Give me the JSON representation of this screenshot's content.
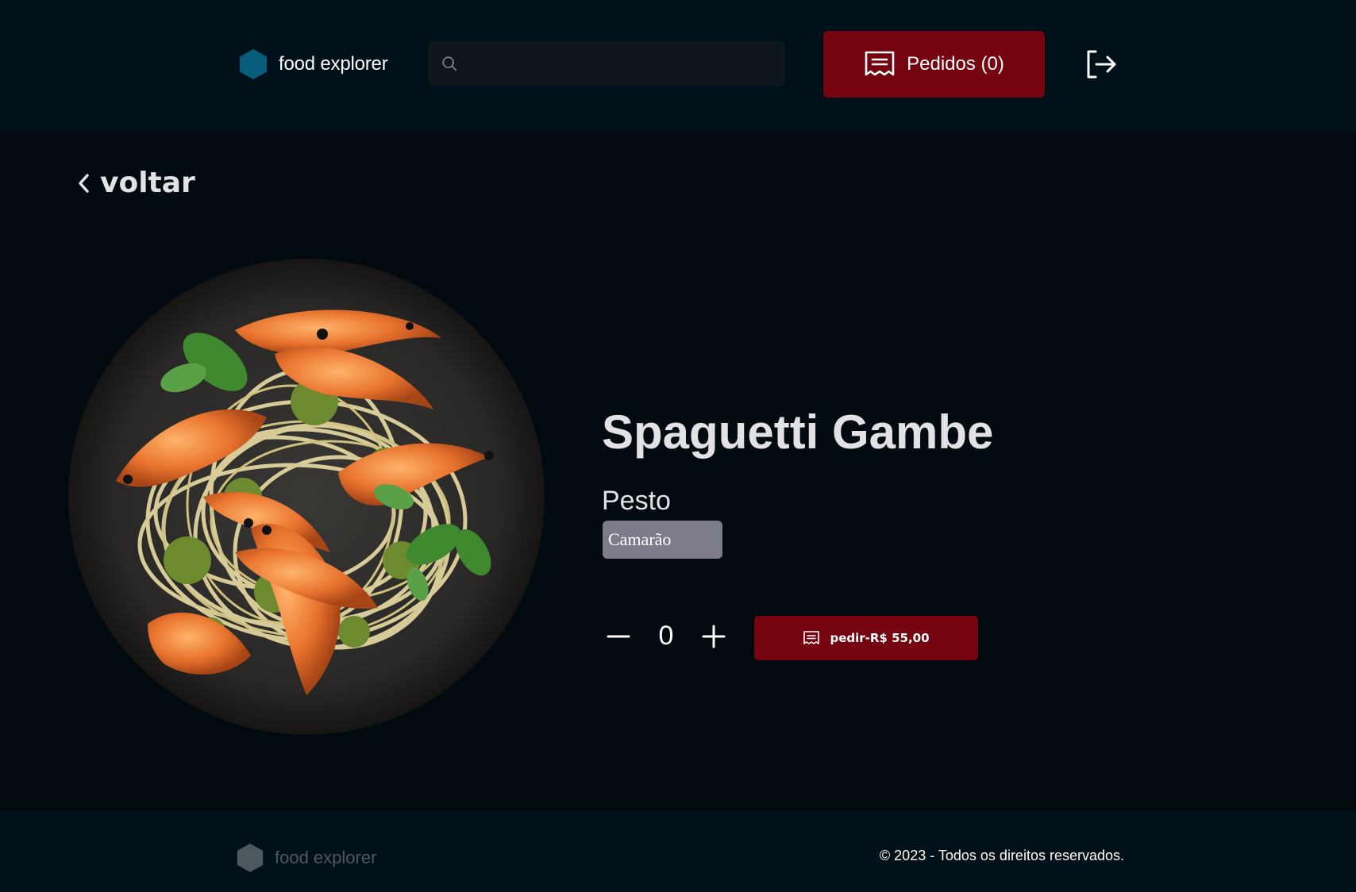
{
  "header": {
    "brand_name": "food explorer",
    "search": {
      "value": "",
      "placeholder": ""
    },
    "orders_button": {
      "label": "Pedidos (0)",
      "icon": "receipt-icon"
    },
    "logout": {
      "icon": "sign-out-icon"
    }
  },
  "back": {
    "label": "voltar",
    "icon": "chevron-left-icon"
  },
  "dish": {
    "image": "shrimp-pesto-spaghetti-photo",
    "title": "Spaguetti Gambe",
    "description": "Pesto",
    "ingredients": [
      "Camarão"
    ],
    "quantity": "0",
    "order_button": {
      "label": "pedir-R$ 55,00",
      "icon": "receipt-icon"
    }
  },
  "footer": {
    "brand_name": "food explorer",
    "copyright": "© 2023 - Todos os direitos reservados."
  },
  "colors": {
    "background": "#000A0F",
    "header_bg": "#00111A",
    "accent": "#750310",
    "brand_blue": "#065E7C",
    "tag_bg": "#7C7C8A"
  }
}
